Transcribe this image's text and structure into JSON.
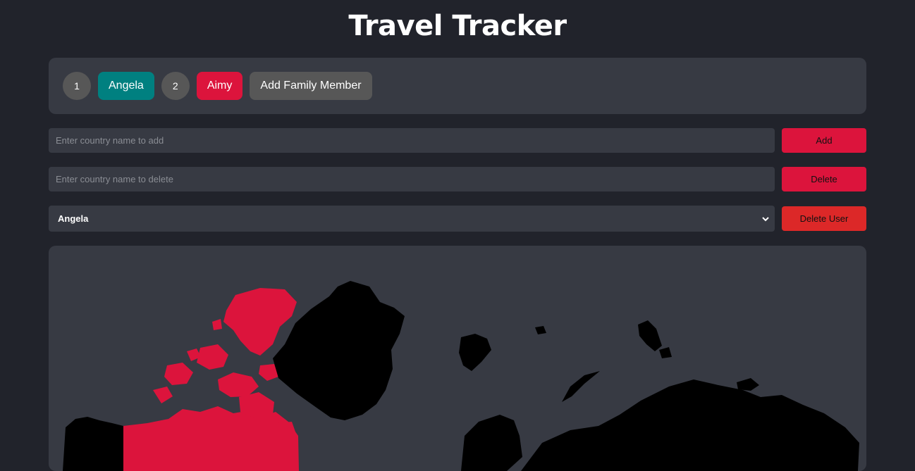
{
  "header": {
    "title": "Travel Tracker"
  },
  "members": [
    {
      "id_label": "1",
      "name": "Angela",
      "color": "#008080"
    },
    {
      "id_label": "2",
      "name": "Aimy",
      "color": "#dc143c"
    }
  ],
  "add_member_label": "Add Family Member",
  "add_form": {
    "placeholder": "Enter country name to add",
    "button_label": "Add"
  },
  "delete_form": {
    "placeholder": "Enter country name to delete",
    "button_label": "Delete"
  },
  "user_select": {
    "selected": "Angela",
    "button_label": "Delete User"
  },
  "colors": {
    "background": "#21232b",
    "panel": "#373a43",
    "accent_red": "#dc143c",
    "delete_user_red": "#dc2828",
    "teal": "#008080",
    "visited": "#dc143c",
    "unvisited": "#000000"
  },
  "map": {
    "visited_regions": [
      "Canada"
    ]
  }
}
